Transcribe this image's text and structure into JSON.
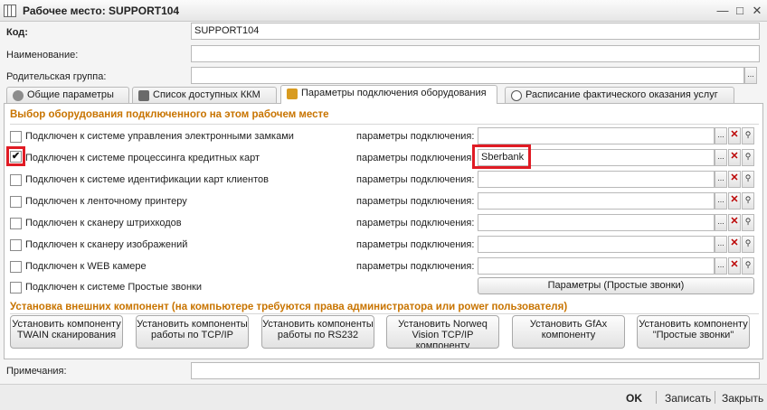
{
  "window": {
    "title": "Рабочее место: SUPPORT104"
  },
  "header": {
    "code_label": "Код:",
    "code_value": "SUPPORT104",
    "name_label": "Наименование:",
    "name_value": "",
    "parent_label": "Родительская группа:",
    "parent_value": ""
  },
  "tabs": [
    {
      "label": "Общие параметры"
    },
    {
      "label": "Список доступных ККМ"
    },
    {
      "label": "Параметры подключения оборудования"
    },
    {
      "label": "Расписание фактического оказания услуг"
    }
  ],
  "equipment": {
    "section_title": "Выбор оборудования подключенного на этом рабочем месте",
    "params_label": "параметры подключения:",
    "rows": [
      {
        "label": "Подключен к системе управления электронными замками",
        "checked": false,
        "value": ""
      },
      {
        "label": "Подключен к системе процессинга кредитных карт",
        "checked": true,
        "value": "Sberbank"
      },
      {
        "label": "Подключен к системе идентификации карт клиентов",
        "checked": false,
        "value": ""
      },
      {
        "label": "Подключен к ленточному принтеру",
        "checked": false,
        "value": ""
      },
      {
        "label": "Подключен к сканеру штрихкодов",
        "checked": false,
        "value": ""
      },
      {
        "label": "Подключен к сканеру изображений",
        "checked": false,
        "value": ""
      },
      {
        "label": "Подключен к WEB камере",
        "checked": false,
        "value": ""
      },
      {
        "label": "Подключен к системе Простые звонки",
        "checked": false,
        "value": ""
      }
    ],
    "simple_calls_button": "Параметры (Простые звонки)"
  },
  "components": {
    "section_title": "Установка внешних компонент (на компьютере требуются права администратора или power пользователя)",
    "buttons": [
      "Установить компоненту TWAIN сканирования",
      "Установить компоненты работы по TCP/IP",
      "Установить компоненты работы по RS232",
      "Установить Norweq Vision TCP/IP компоненту",
      "Установить GfAx компоненту",
      "Установить компоненту \"Простые звонки\""
    ]
  },
  "notes": {
    "label": "Примечания:",
    "value": ""
  },
  "footer": {
    "ok": "OK",
    "save": "Записать",
    "close": "Закрыть"
  },
  "colors": {
    "section_title": "#c87400",
    "highlight_box": "#e01b24",
    "delete_x": "#b00000"
  }
}
